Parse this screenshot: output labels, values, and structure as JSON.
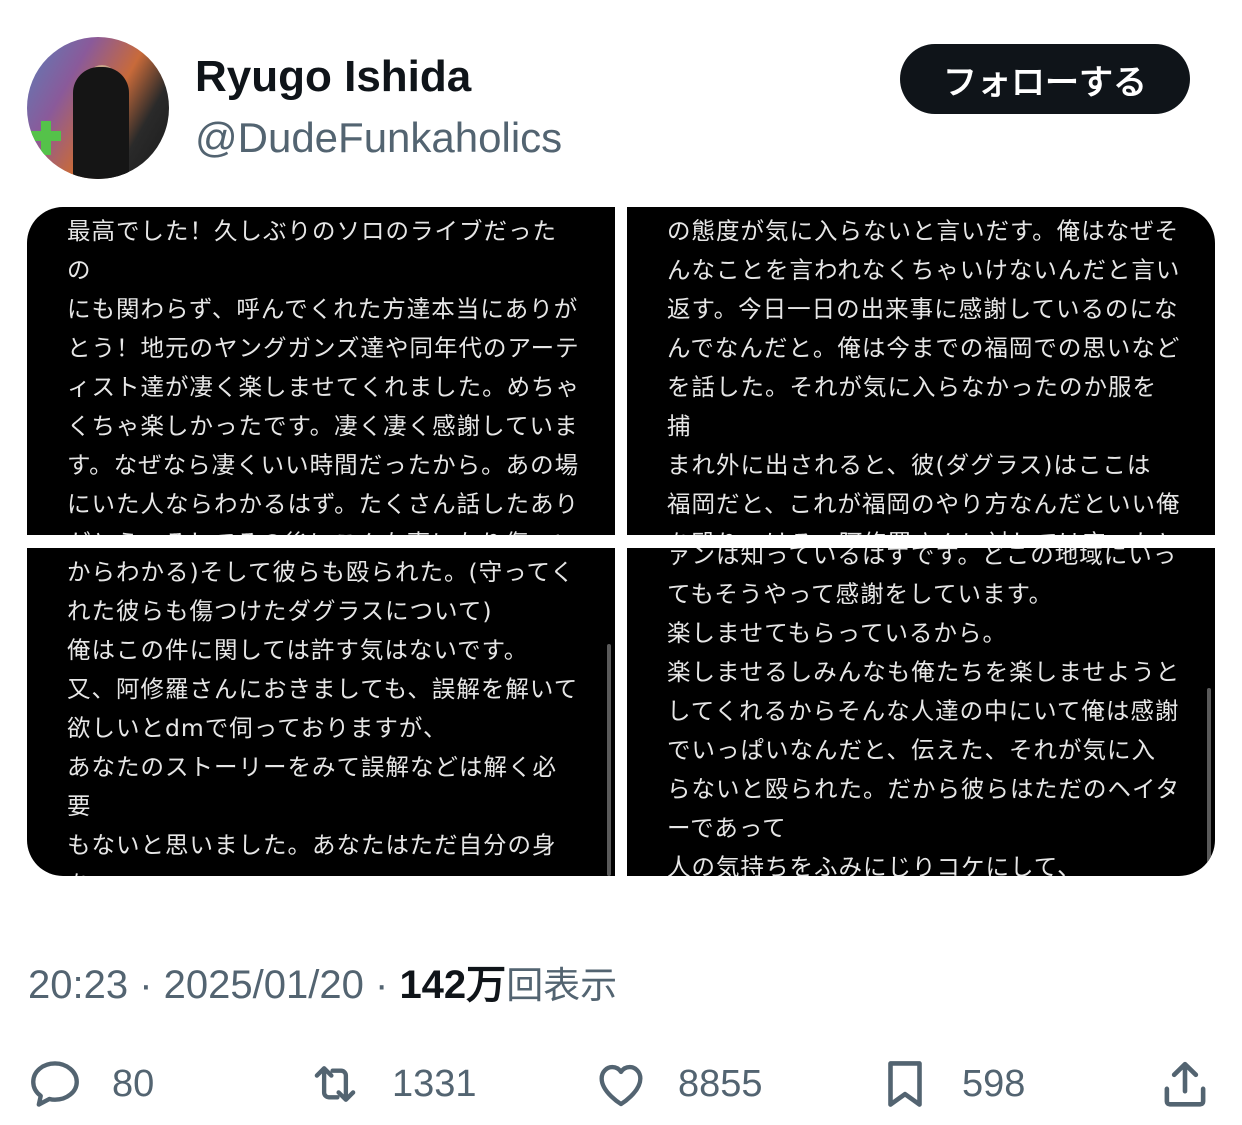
{
  "user": {
    "name": "Ryugo Ishida",
    "handle": "@DudeFunkaholics"
  },
  "follow_label": "フォローする",
  "images": [
    {
      "text": "最高でした！久しぶりのソロのライブだったの\nにも関わらず、呼んでくれた方達本当にありが\nとう！地元のヤングガンズ達や同年代のアーテ\nィスト達が凄く楽しませてくれました。めちゃ\nくちゃ楽しかったです。凄く凄く感謝していま\nす。なぜなら凄くいい時間だったから。あの場\nにいた人ならわかるはず。たくさん話したあり\nがとう。そしてその後にこんな事になり傷つい"
    },
    {
      "text": "の態度が気に入らないと言いだす。俺はなぜそ\nんなことを言われなくちゃいけないんだと言い\n返す。今日一日の出来事に感謝しているのにな\nんでなんだと。俺は今までの福岡での思いなど\nを話した。それが気に入らなかったのか服を捕\nまれ外に出されると、彼(ダグラス)はここは\n福岡だと、これが福岡のやり方なんだといい俺\nを殴りつける。阿修羅さんに対しては守ったと"
    },
    {
      "text": "からわかる)そして彼らも殴られた。(守ってく\nれた彼らも傷つけたダグラスについて)\n俺はこの件に関しては許す気はないです。\n又、阿修羅さんにおきましても、誤解を解いて\n欲しいとdmで伺っておりますが、\nあなたのストーリーをみて誤解などは解く必要\nもないと思いました。あなたはただ自分の身を\n守りたいだけで、そもそも俺の態度が悪いって"
    },
    {
      "text": "ァンは知っているはずです。どこの地域にいっ\nてもそうやって感謝をしています。\n楽しませてもらっているから。\n楽しませるしみんなも俺たちを楽しませようと\nしてくれるからそんな人達の中にいて俺は感謝\nでいっぱいなんだと、伝えた、それが気に入\nらないと殴られた。だから彼らはただのヘイタ\nーであって\n人の気持ちをふみにじりコケにして、"
    }
  ],
  "meta": {
    "time": "20:23",
    "date": "2025/01/20",
    "views_count": "142万",
    "views_label": "回表示"
  },
  "actions": {
    "replies": "80",
    "reposts": "1331",
    "likes": "8855",
    "bookmarks": "598"
  }
}
